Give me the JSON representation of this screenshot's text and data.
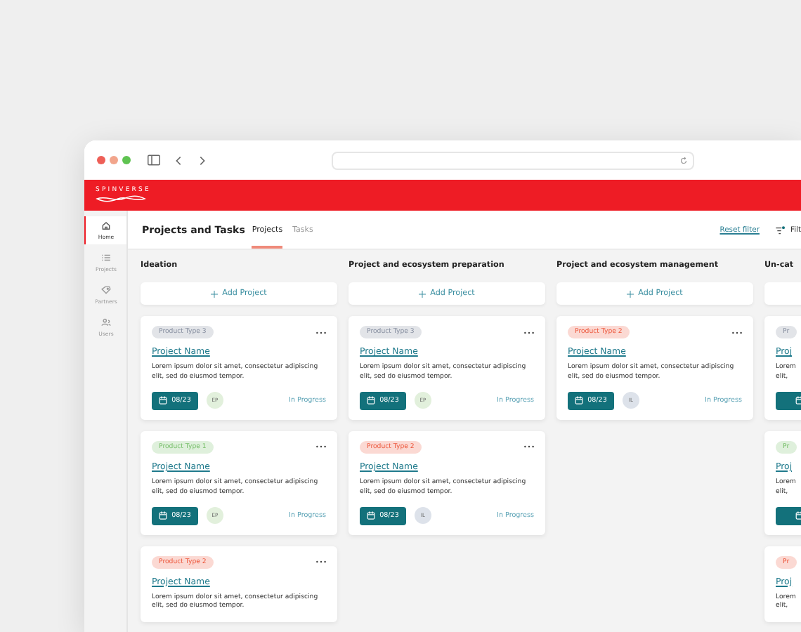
{
  "brand": {
    "name": "SPINVERSE"
  },
  "sidebar": [
    {
      "label": "Home",
      "kind": "home",
      "selected": true
    },
    {
      "label": "Projects",
      "kind": "list",
      "selected": false
    },
    {
      "label": "Partners",
      "kind": "tag",
      "selected": false
    },
    {
      "label": "Users",
      "kind": "users",
      "selected": false
    }
  ],
  "header": {
    "title": "Projects and Tasks",
    "tabs": [
      {
        "label": "Projects",
        "selected": true
      },
      {
        "label": "Tasks",
        "selected": false
      }
    ],
    "reset": "Reset filter",
    "filter": "Filt"
  },
  "columns": [
    {
      "title": "Ideation",
      "add_label": "Add Project",
      "cards": [
        {
          "kind": "full",
          "type": "Product Type 3",
          "color": "#e2e4e8",
          "name": "Project Name",
          "description": "Lorem ipsum dolor sit amet, consectetur adipiscing elit, sed do eiusmod tempor.",
          "date": "08/23",
          "avatar": {
            "initials": "EP",
            "color": "#e2f0dc"
          },
          "status": "In Progress"
        },
        {
          "kind": "full",
          "type": "Product Type 1",
          "color": "#dff0dc",
          "name": "Project Name",
          "description": "Lorem ipsum dolor sit amet, consectetur adipiscing elit, sed do eiusmod tempor.",
          "date": "08/23",
          "avatar": {
            "initials": "EP",
            "color": "#e2f0dc"
          },
          "status": "In Progress"
        },
        {
          "kind": "top",
          "type": "Product Type 2",
          "color": "#fbd9d3",
          "name": "Project Name",
          "description": "Lorem ipsum dolor sit amet, consectetur adipiscing elit, sed do eiusmod tempor."
        }
      ]
    },
    {
      "title": "Project and ecosystem preparation",
      "add_label": "Add Project",
      "cards": [
        {
          "kind": "full",
          "type": "Product Type 3",
          "color": "#e2e4e8",
          "name": "Project Name",
          "description": "Lorem ipsum dolor sit amet, consectetur adipiscing elit, sed do eiusmod tempor.",
          "date": "08/23",
          "avatar": {
            "initials": "EP",
            "color": "#e2f0dc"
          },
          "status": "In Progress"
        },
        {
          "kind": "full",
          "type": "Product Type 2",
          "color": "#fbd9d3",
          "name": "Project Name",
          "description": "Lorem ipsum dolor sit amet, consectetur adipiscing elit, sed do eiusmod tempor.",
          "date": "08/23",
          "avatar": {
            "initials": "IL",
            "color": "#dde2ea"
          },
          "status": "In Progress"
        }
      ]
    },
    {
      "title": "Project and ecosystem management",
      "add_label": "Add Project",
      "cards": [
        {
          "kind": "full",
          "type": "Product Type 2",
          "color": "#fbd9d3",
          "name": "Project Name",
          "description": "Lorem ipsum dolor sit amet, consectetur adipiscing elit, sed do eiusmod tempor.",
          "date": "08/23",
          "avatar": {
            "initials": "IL",
            "color": "#dde2ea"
          },
          "status": "In Progress"
        }
      ]
    },
    {
      "title": "Un-cat",
      "cards": [
        {
          "kind": "icon_only",
          "type": "Pr",
          "color": "#e2e4e8",
          "name": "Proj",
          "description": "Lorem\nelit,"
        },
        {
          "kind": "icon_only",
          "type": "Pr",
          "color": "#dff0dc",
          "name": "Proj",
          "description": "Lorem\nelit,"
        },
        {
          "kind": "top",
          "type": "Pr",
          "color": "#fbd9d3",
          "name": "Proj",
          "description": "Lorem\nelit,"
        }
      ]
    }
  ]
}
